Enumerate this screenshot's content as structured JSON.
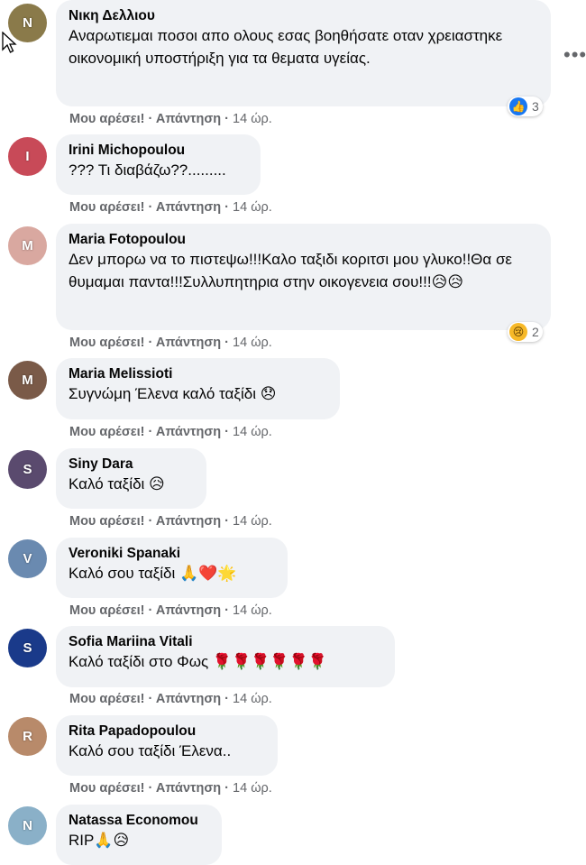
{
  "more_label": "•••",
  "comments": [
    {
      "name": "Νικη Δελλιου",
      "text": "Αναρωτιεμαι ποσοι απο ολους εσας βοηθήσατε οταν χρειαστηκε οικονομική υποστήριξη για τα θεματα υγείας.",
      "like": "Μου αρέσει!",
      "sep": "·",
      "reply": "Απάντηση",
      "time": "14 ώρ.",
      "reaction_icon": "like-icon",
      "reaction_glyph": "👍",
      "reaction_count": "3",
      "avatar_color": "#8a7a4a",
      "avatar_initial": "Ν"
    },
    {
      "name": "Irini Michopoulou",
      "text": "??? Τι διαβάζω??.........",
      "like": "Μου αρέσει!",
      "sep": "·",
      "reply": "Απάντηση",
      "time": "14 ώρ.",
      "avatar_color": "#c84a58",
      "avatar_initial": "I"
    },
    {
      "name": "Maria Fotopoulou",
      "text": "Δεν μπορω να το πιστεψω!!!Καλο ταξιδι κοριτσι μου γλυκο!!Θα σε θυμαμαι παντα!!!Συλλυπητηρια στην οικογενεια σου!!!😥😥",
      "like": "Μου αρέσει!",
      "sep": "·",
      "reply": "Απάντηση",
      "time": "14 ώρ.",
      "reaction_icon": "sad-icon",
      "reaction_glyph": "😢",
      "reaction_count": "2",
      "avatar_color": "#d9a8a0",
      "avatar_initial": "M"
    },
    {
      "name": "Maria Melissioti",
      "text": "Συγνώμη Έλενα καλό ταξίδι 😞",
      "like": "Μου αρέσει!",
      "sep": "·",
      "reply": "Απάντηση",
      "time": "14 ώρ.",
      "avatar_color": "#7a5a48",
      "avatar_initial": "M"
    },
    {
      "name": "Siny Dara",
      "text": "Καλό ταξίδι 😥",
      "like": "Μου αρέσει!",
      "sep": "·",
      "reply": "Απάντηση",
      "time": "14 ώρ.",
      "avatar_color": "#5a4a6e",
      "avatar_initial": "S"
    },
    {
      "name": "Veroniki Spanaki",
      "text": "Καλό σου ταξίδι 🙏❤️🌟",
      "like": "Μου αρέσει!",
      "sep": "·",
      "reply": "Απάντηση",
      "time": "14 ώρ.",
      "avatar_color": "#6a8ab0",
      "avatar_initial": "V"
    },
    {
      "name": "Sofia Mariina Vitali",
      "text": "Καλό ταξίδι στο Φως 🌹🌹🌹🌹🌹🌹",
      "like": "Μου αρέσει!",
      "sep": "·",
      "reply": "Απάντηση",
      "time": "14 ώρ.",
      "avatar_color": "#1a3a8a",
      "avatar_initial": "S"
    },
    {
      "name": "Rita Papadopoulou",
      "text": "Καλό σου ταξίδι Έλενα..",
      "like": "Μου αρέσει!",
      "sep": "·",
      "reply": "Απάντηση",
      "time": "14 ώρ.",
      "avatar_color": "#b88a6a",
      "avatar_initial": "R"
    },
    {
      "name": "Natassa Economou",
      "text": "RIP🙏😥",
      "avatar_color": "#8ab0c8",
      "avatar_initial": "N"
    }
  ]
}
